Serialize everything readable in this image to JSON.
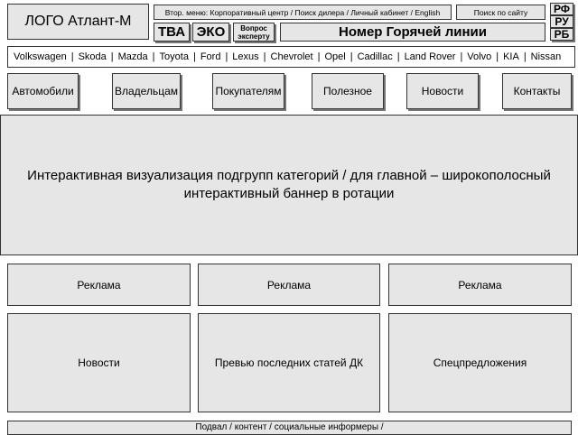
{
  "header": {
    "logo": "ЛОГО Атлант-М",
    "secondary_menu": "Втор. меню: Корпоративный  центр / Поиск дилера / Личный кабинет  / English",
    "search_label": "Поиск по сайту",
    "tba_label": "ТВА",
    "eco_label": "ЭКО",
    "ask_expert_line1": "Вопрос",
    "ask_expert_line2": "эксперту",
    "hotline": "Номер Горячей линии",
    "langs": [
      "РФ",
      "РУ",
      "РБ"
    ]
  },
  "brands": [
    "Volkswagen",
    "Skoda",
    "Mazda",
    "Toyota",
    "Ford",
    "Lexus",
    "Chevrolet",
    "Opel",
    "Cadillac",
    "Land Rover",
    "Volvo",
    "KIA",
    "Nissan"
  ],
  "brand_separator": "|",
  "nav": [
    "Автомобили",
    "Владельцам",
    "Покупателям",
    "Полезное",
    "Новости",
    "Контакты"
  ],
  "banner_text": "Интерактивная визуализация подгрупп категорий / для главной – широкополосный интерактивный баннер в ротации",
  "ads": [
    "Реклама",
    "Реклама",
    "Реклама"
  ],
  "blocks": [
    "Новости",
    "Превью последних статей ДК",
    "Спецпредложения"
  ],
  "footer": "Подвал / контент / социальные информеры /"
}
